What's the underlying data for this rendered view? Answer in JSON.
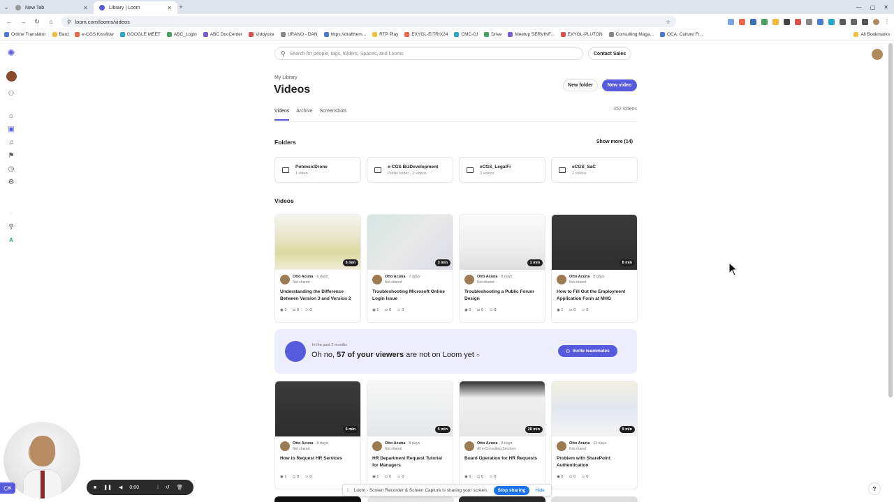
{
  "browser": {
    "tabs": [
      {
        "label": "New Tab",
        "active": false
      },
      {
        "label": "Library | Loom",
        "active": true
      }
    ],
    "url": "loom.com/looms/videos",
    "bookmarks": [
      "Online Translator",
      "Bard",
      "e-CGS Kissflow",
      "GOOGLE MEET",
      "ABC_Login",
      "ABC DocCenter",
      "Viddyoze",
      "URANO - DAN",
      "https://drafthem...",
      "RTP Play",
      "EXYGL-EITRIX24",
      "CMC-GI",
      "Drive",
      "Meetup SERVINF...",
      "EXYGL-PLUTON",
      "Consulting Maga...",
      "OCA: Culture Fr..."
    ],
    "all_bookmarks": "All Bookmarks"
  },
  "header": {
    "search_placeholder": "Search for people, tags, folders, Spaces, and Looms",
    "contact_sales": "Contact Sales"
  },
  "page": {
    "breadcrumb": "My Library",
    "title": "Videos",
    "new_folder": "New folder",
    "new_video": "New video",
    "tabs": [
      "Videos",
      "Archive",
      "Screenshots"
    ],
    "video_count": "352 videos"
  },
  "folders_section": {
    "heading": "Folders",
    "show_more": "Show more (14)",
    "items": [
      {
        "name": "PotensicDrone",
        "sub": "1 video"
      },
      {
        "name": "e-CGS BizDevelopment",
        "sub": "Public folder · 3 videos"
      },
      {
        "name": "eCGS_LegalFi",
        "sub": "3 videos"
      },
      {
        "name": "eCGS_SaC",
        "sub": "2 videos"
      }
    ]
  },
  "videos_section": {
    "heading": "Videos",
    "items": [
      {
        "author": "Otto Acuna",
        "age": "· 6 days",
        "shared": "Not shared",
        "title": "Understanding the Difference Between Version 3 and Version 2",
        "duration": "5 min",
        "views": "3",
        "comments": "0",
        "reactions": "0"
      },
      {
        "author": "Otto Acuna",
        "age": "· 7 days",
        "shared": "Not shared",
        "title": "Troubleshooting Microsoft Online Login Issue",
        "duration": "3 min",
        "views": "1",
        "comments": "0",
        "reactions": "0"
      },
      {
        "author": "Otto Acuna",
        "age": "· 8 days",
        "shared": "Not shared",
        "title": "Troubleshooting a Public Forum Design",
        "duration": "1 min",
        "views": "0",
        "comments": "0",
        "reactions": "0"
      },
      {
        "author": "Otto Acuna",
        "age": "· 8 days",
        "shared": "Not shared",
        "title": "How to Fill Out the Employment Application Form at MHG",
        "duration": "8 min",
        "views": "1",
        "comments": "0",
        "reactions": "0"
      },
      {
        "author": "Otto Acuna",
        "age": "· 8 days",
        "shared": "Not shared",
        "title": "How to Request HR Services",
        "duration": "5 min",
        "views": "1",
        "comments": "0",
        "reactions": "0"
      },
      {
        "author": "Otto Acuna",
        "age": "· 8 days",
        "shared": "Not shared",
        "title": "HR Department Request Tutorial for Managers",
        "duration": "5 min",
        "views": "1",
        "comments": "0",
        "reactions": "0"
      },
      {
        "author": "Otto Acuna",
        "age": "· 8 days",
        "shared": "All e-Consulting Services",
        "title": "Board Operation for HR Requests",
        "duration": "28 min",
        "views": "5",
        "comments": "0",
        "reactions": "0"
      },
      {
        "author": "Otto Acuna",
        "age": "· 11 days",
        "shared": "Not shared",
        "title": "Problem with SharePoint Authentication",
        "duration": "9 min",
        "views": "0",
        "comments": "0",
        "reactions": "0"
      }
    ]
  },
  "banner": {
    "small": "In the past 2 months",
    "prefix": "Oh no, ",
    "bold": "57 of your viewers",
    "suffix": " are not on Loom yet",
    "button": "Invite teammates"
  },
  "recorder": {
    "timer": "0:00",
    "share_text": "Loom - Screen Recorder & Screen Capture is sharing your screen.",
    "stop": "Stop sharing",
    "hide": "Hide"
  },
  "colors": {
    "accent": "#565add",
    "banner_bg": "#eceefd"
  }
}
